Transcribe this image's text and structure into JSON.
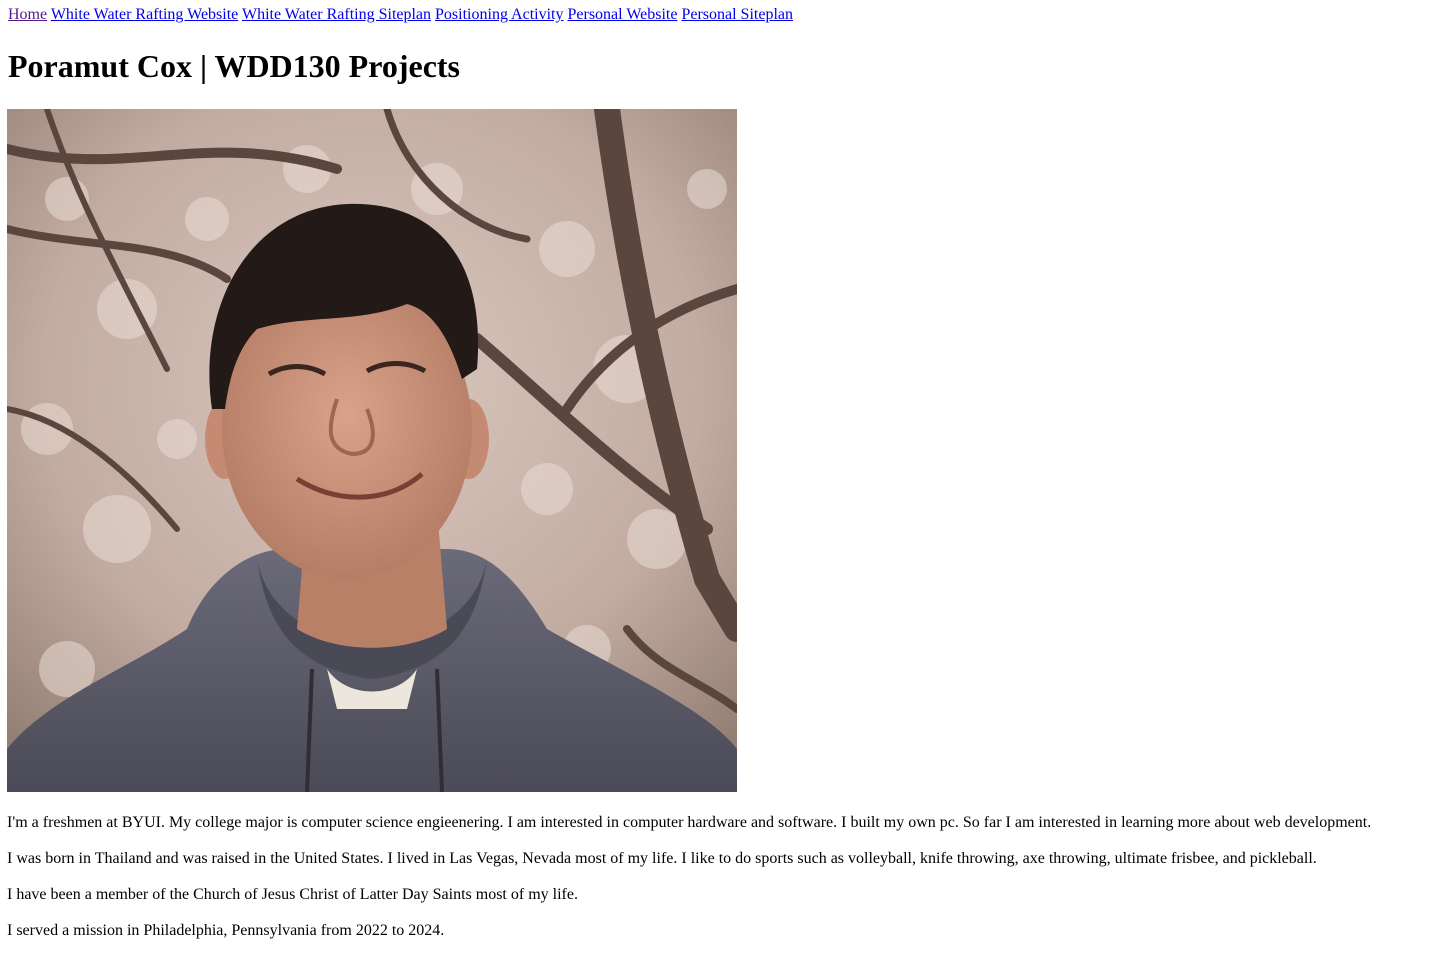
{
  "nav": {
    "links": [
      {
        "label": "Home"
      },
      {
        "label": "White Water Rafting Website"
      },
      {
        "label": "White Water Rafting Siteplan"
      },
      {
        "label": "Positioning Activity"
      },
      {
        "label": "Personal Website"
      },
      {
        "label": "Personal Siteplan"
      }
    ]
  },
  "header": {
    "title": "Poramut Cox | WDD130 Projects"
  },
  "colors": {
    "link": "#0000ee",
    "visited_link": "#551a8b",
    "text": "#000000",
    "background": "#ffffff"
  },
  "main": {
    "photo": {
      "icon": "portrait-photo"
    },
    "paragraphs": [
      "I'm a freshmen at BYUI. My college major is computer science engieenering. I am interested in computer hardware and software. I built my own pc. So far I am interested in learning more about web development.",
      "I was born in Thailand and was raised in the United States. I lived in Las Vegas, Nevada most of my life. I like to do sports such as volleyball, knife throwing, axe throwing, ultimate frisbee, and pickleball.",
      "I have been a member of the Church of Jesus Christ of Latter Day Saints most of my life.",
      "I served a mission in Philadelphia, Pennsylvania from 2022 to 2024."
    ]
  }
}
